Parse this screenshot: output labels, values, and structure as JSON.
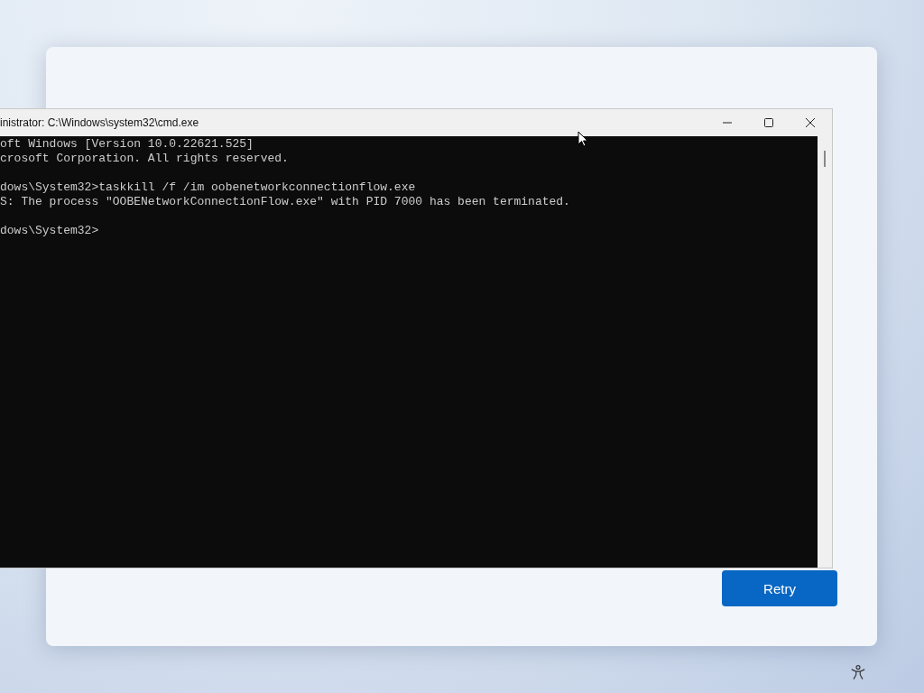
{
  "console_window": {
    "title": "inistrator: C:\\Windows\\system32\\cmd.exe",
    "blocks": [
      [
        "oft Windows [Version 10.0.22621.525]",
        "crosoft Corporation. All rights reserved."
      ],
      [
        "dows\\System32>taskkill /f /im oobenetworkconnectionflow.exe",
        "S: The process \"OOBENetworkConnectionFlow.exe\" with PID 7000 has been terminated."
      ],
      [
        "dows\\System32>"
      ]
    ]
  },
  "dialog": {
    "buttons": [
      "Retry"
    ]
  }
}
